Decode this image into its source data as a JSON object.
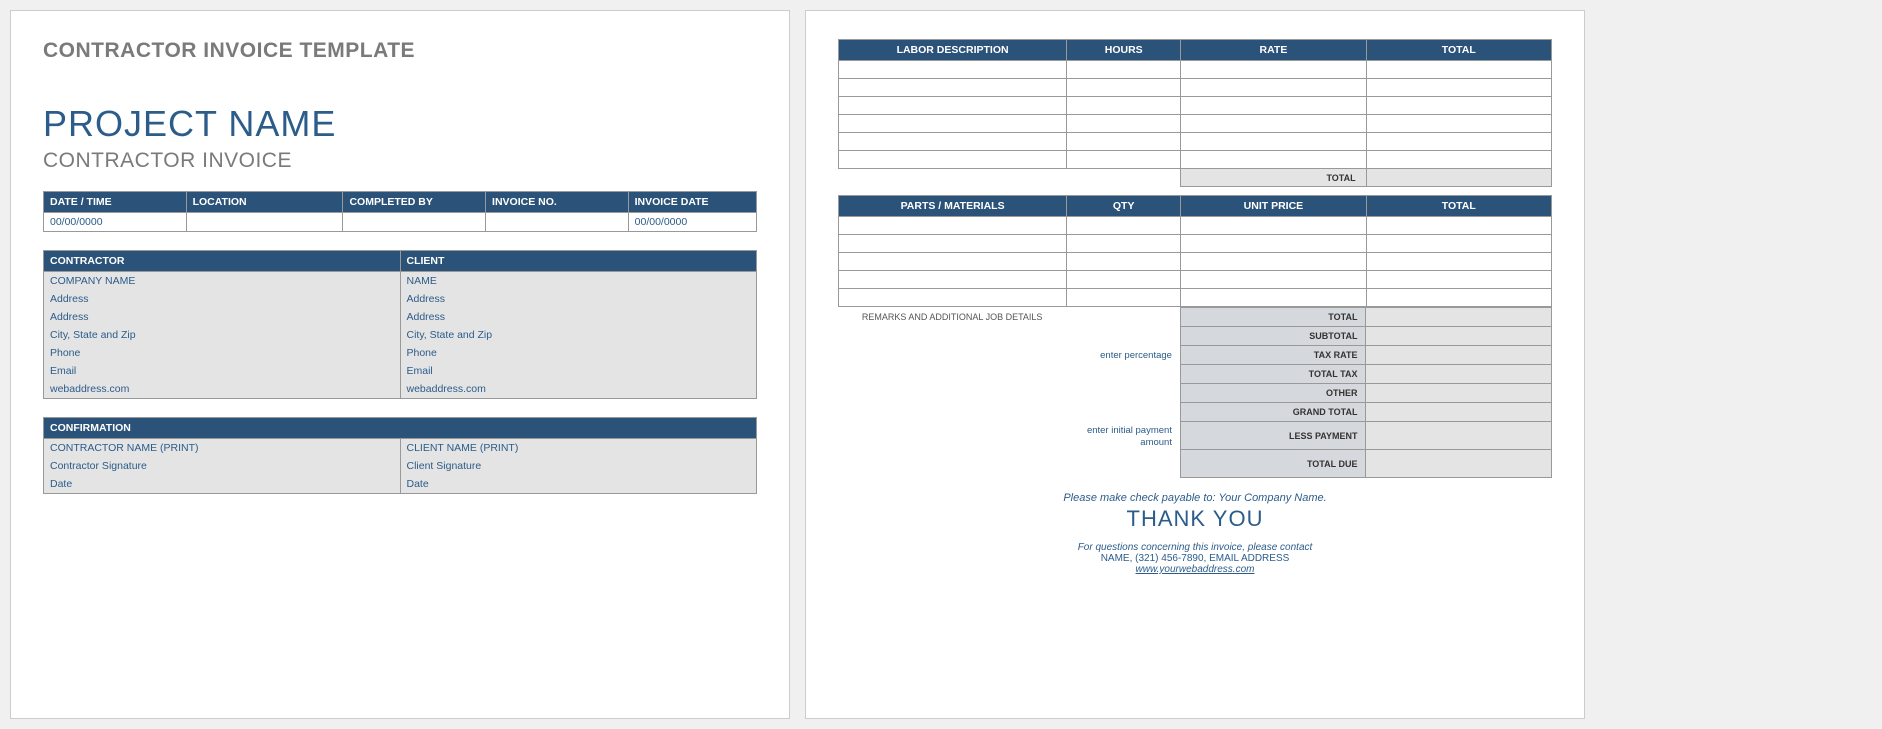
{
  "page1": {
    "template_title": "CONTRACTOR INVOICE TEMPLATE",
    "project_name": "PROJECT NAME",
    "subtitle": "CONTRACTOR INVOICE",
    "meta_headers": [
      "DATE / TIME",
      "LOCATION",
      "COMPLETED BY",
      "INVOICE NO.",
      "INVOICE DATE"
    ],
    "meta_values": [
      "00/00/0000",
      "",
      "",
      "",
      "00/00/0000"
    ],
    "contractor_header": "CONTRACTOR",
    "client_header": "CLIENT",
    "contractor": [
      "COMPANY NAME",
      "Address",
      "Address",
      "City, State and Zip",
      "Phone",
      "Email",
      "webaddress.com"
    ],
    "client": [
      "NAME",
      "Address",
      "Address",
      "City, State and Zip",
      "Phone",
      "Email",
      "webaddress.com"
    ],
    "confirmation_header": "CONFIRMATION",
    "conf_left": [
      "CONTRACTOR NAME (PRINT)",
      "Contractor Signature",
      "Date"
    ],
    "conf_right": [
      "CLIENT NAME (PRINT)",
      "Client Signature",
      "Date"
    ]
  },
  "page2": {
    "labor_headers": [
      "LABOR DESCRIPTION",
      "HOURS",
      "RATE",
      "TOTAL"
    ],
    "labor_total_label": "TOTAL",
    "parts_headers": [
      "PARTS / MATERIALS",
      "QTY",
      "UNIT PRICE",
      "TOTAL"
    ],
    "remarks_label": "REMARKS AND ADDITIONAL JOB DETAILS",
    "hint_percentage": "enter percentage",
    "hint_payment": "enter initial payment amount",
    "summary_labels": [
      "TOTAL",
      "SUBTOTAL",
      "TAX RATE",
      "TOTAL TAX",
      "OTHER",
      "GRAND TOTAL",
      "LESS PAYMENT",
      "TOTAL DUE"
    ],
    "footer_payable": "Please make check payable to: Your Company Name.",
    "footer_thank": "THANK YOU",
    "footer_contact1": "For questions concerning this invoice, please contact",
    "footer_contact2": "NAME, (321) 456-7890, EMAIL ADDRESS",
    "footer_web": "www.yourwebaddress.com"
  }
}
